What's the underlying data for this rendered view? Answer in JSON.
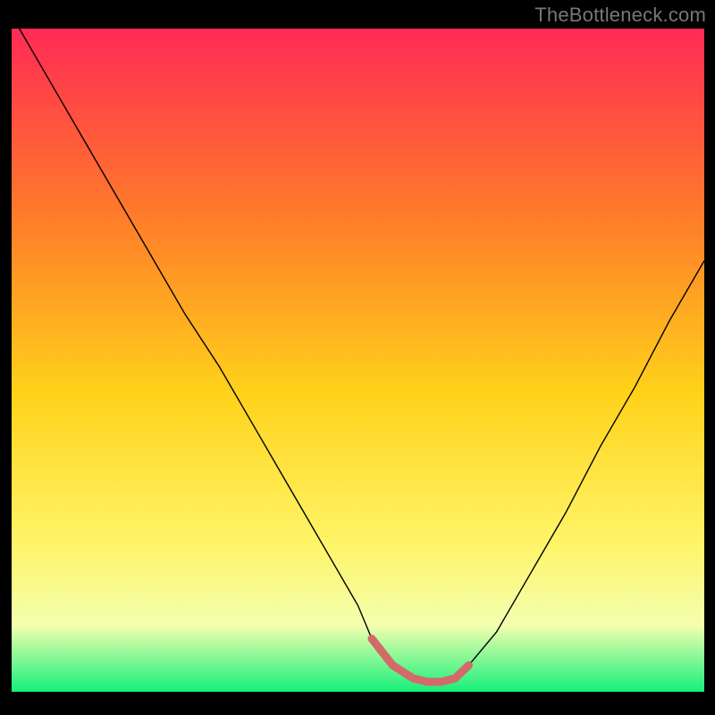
{
  "watermark": "TheBottleneck.com",
  "colors": {
    "frame_bg": "#000000",
    "gradient_top": "#ff2a55",
    "gradient_mid1": "#ff7b2a",
    "gradient_mid2": "#ffd21a",
    "gradient_mid3": "#fff56a",
    "gradient_mid4": "#f3ffb0",
    "gradient_bottom": "#15f07a",
    "curve_stroke": "#000000",
    "trough_stroke": "#d36a6a"
  },
  "chart_data": {
    "type": "line",
    "title": "",
    "xlabel": "",
    "ylabel": "",
    "xlim": [
      0,
      100
    ],
    "ylim": [
      0,
      100
    ],
    "series": [
      {
        "name": "bottleneck_curve",
        "x": [
          0,
          5,
          10,
          15,
          20,
          25,
          30,
          35,
          40,
          45,
          50,
          52,
          55,
          58,
          60,
          62,
          64,
          66,
          70,
          75,
          80,
          85,
          90,
          95,
          100
        ],
        "y": [
          102,
          93,
          84,
          75,
          66,
          57,
          49,
          40,
          31,
          22,
          13,
          8,
          4,
          2,
          1.5,
          1.5,
          2,
          4,
          9,
          18,
          27,
          37,
          46,
          56,
          65
        ]
      }
    ],
    "trough_segment": {
      "x": [
        52,
        55,
        58,
        60,
        62,
        64,
        66
      ],
      "y": [
        8,
        4,
        2,
        1.5,
        1.5,
        2,
        4
      ]
    }
  }
}
